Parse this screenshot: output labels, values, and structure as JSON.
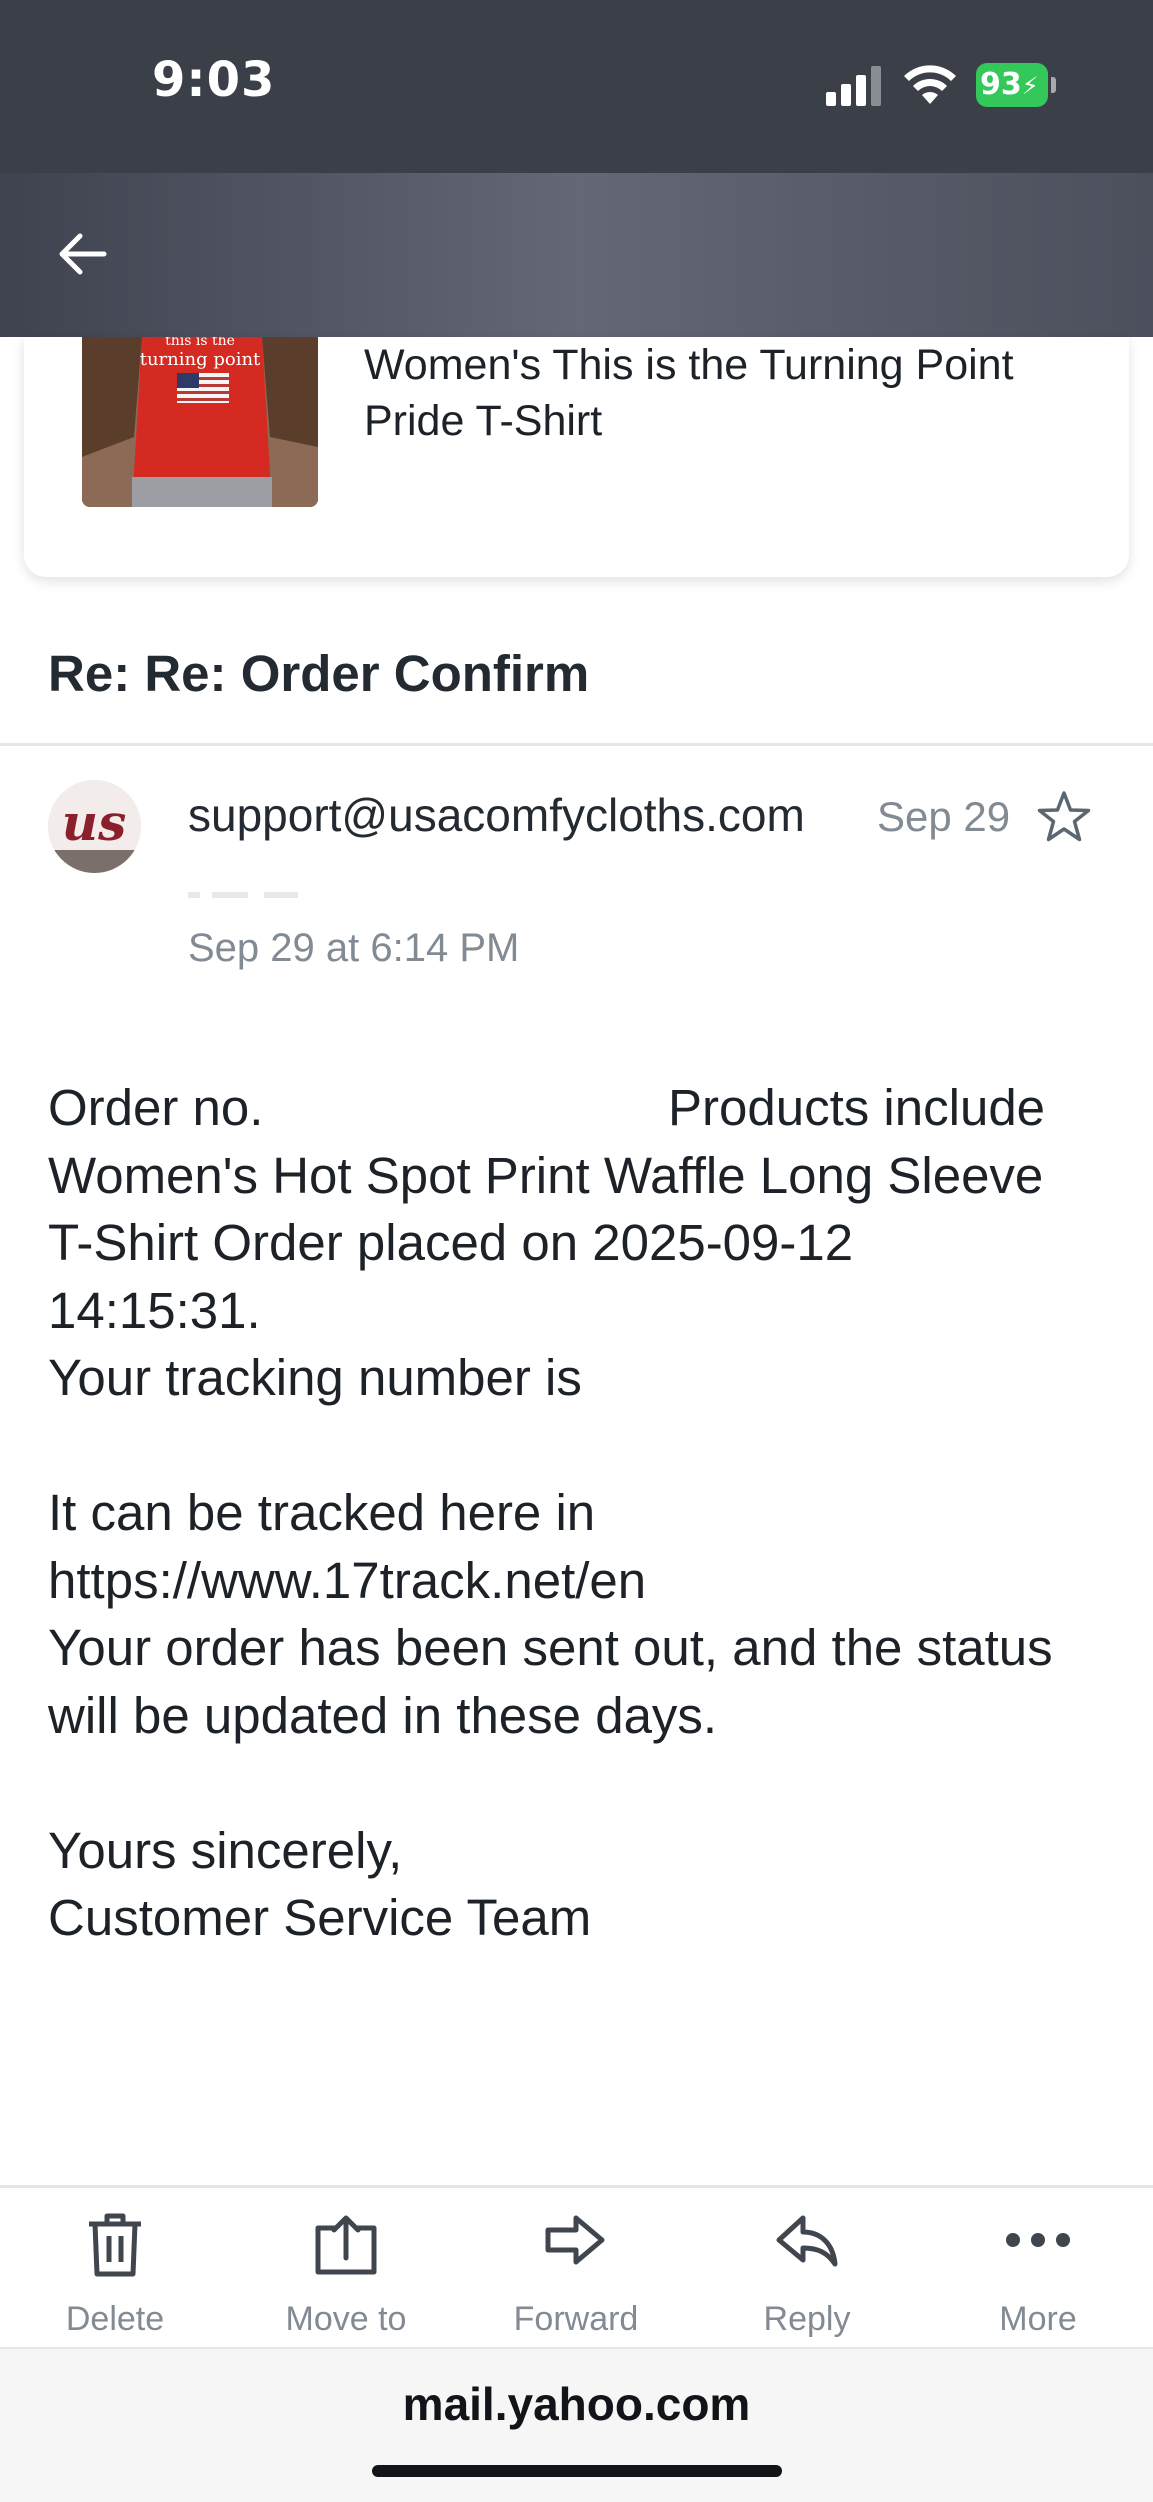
{
  "status_bar": {
    "time": "9:03",
    "battery_text": "93",
    "battery_color": "#34c759"
  },
  "product": {
    "title": "Women's This is the Turning Point Pride T-Shirt",
    "thumbnail_text_line1": "this is the",
    "thumbnail_text_line2": "turning point"
  },
  "email": {
    "subject": "Re: Re: Order Confirm",
    "sender": "support@usacomfycloths.com",
    "date_short": "Sep 29",
    "date_full": "Sep 29 at 6:14 PM",
    "avatar_text": "us",
    "body": {
      "order_no_label": "Order no.",
      "products_include": "Products include",
      "line2": "Women's Hot Spot Print Waffle Long Sleeve",
      "line3": "T-Shirt Order placed on 2025-09-12",
      "line4": "14:15:31.",
      "line5": "Your tracking number is",
      "line7": "It can be tracked here in",
      "line8": "https://www.17track.net/en",
      "line9": "Your order has been sent out, and the status",
      "line10": "will be updated in these days.",
      "line12": "Yours sincerely,",
      "line13": "Customer Service Team"
    }
  },
  "toolbar": {
    "delete_label": "Delete",
    "move_label": "Move to",
    "forward_label": "Forward",
    "reply_label": "Reply",
    "more_label": "More"
  },
  "browser": {
    "url": "mail.yahoo.com"
  },
  "icons": {
    "back": "arrow-left",
    "star": "star-outline",
    "delete": "trash",
    "move": "box-arrow-up",
    "forward": "arrow-right-outline",
    "reply": "reply-arrow",
    "more": "three-dots"
  }
}
